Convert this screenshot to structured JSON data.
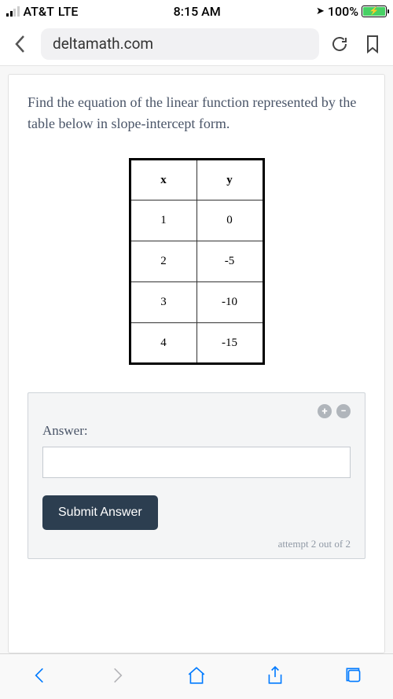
{
  "status": {
    "carrier": "AT&T",
    "network": "LTE",
    "time": "8:15 AM",
    "battery_pct": "100%"
  },
  "browser": {
    "url": "deltamath.com"
  },
  "question": {
    "prompt": "Find the equation of the linear function represented by the table below in slope-intercept form.",
    "table": {
      "headers": {
        "x": "x",
        "y": "y"
      },
      "rows": [
        {
          "x": "1",
          "y": "0"
        },
        {
          "x": "2",
          "y": "-5"
        },
        {
          "x": "3",
          "y": "-10"
        },
        {
          "x": "4",
          "y": "-15"
        }
      ]
    }
  },
  "answer": {
    "label": "Answer:",
    "value": "",
    "submit_label": "Submit Answer",
    "attempt_text": "attempt 2 out of 2"
  }
}
